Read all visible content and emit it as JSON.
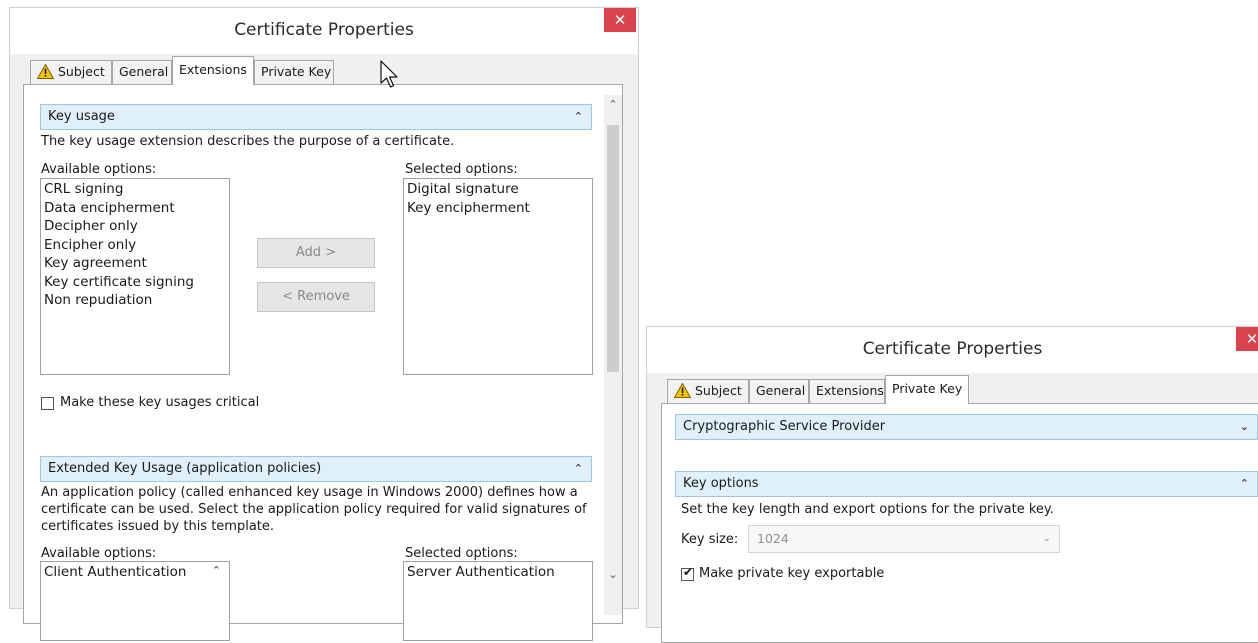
{
  "dialog1": {
    "title": "Certificate Properties",
    "close_glyph": "✕",
    "tabs": [
      {
        "label": "Subject",
        "warning": true
      },
      {
        "label": "General"
      },
      {
        "label": "Extensions",
        "active": true
      },
      {
        "label": "Private Key"
      }
    ],
    "key_usage": {
      "header": "Key usage",
      "description": "The key usage extension describes the purpose of a certificate.",
      "available_label": "Available options:",
      "available": [
        "CRL signing",
        "Data encipherment",
        "Decipher only",
        "Encipher only",
        "Key agreement",
        "Key certificate signing",
        "Non repudiation"
      ],
      "selected_label": "Selected options:",
      "selected": [
        "Digital signature",
        "Key encipherment"
      ],
      "add_label": "Add >",
      "remove_label": "< Remove",
      "critical_label": "Make these key usages critical",
      "critical_checked": false
    },
    "eku": {
      "header": "Extended Key Usage (application policies)",
      "description_lines": [
        "An application policy (called enhanced key usage in Windows 2000) defines how a",
        "certificate can be used. Select the application policy required for valid signatures of",
        "certificates issued by this template."
      ],
      "available_label": "Available options:",
      "available": [
        "Client Authentication"
      ],
      "selected_label": "Selected options:",
      "selected": [
        "Server Authentication"
      ]
    }
  },
  "dialog2": {
    "title": "Certificate Properties",
    "close_glyph": "✕",
    "tabs": [
      {
        "label": "Subject",
        "warning": true
      },
      {
        "label": "General"
      },
      {
        "label": "Extensions"
      },
      {
        "label": "Private Key",
        "active": true
      }
    ],
    "csp_header": "Cryptographic Service Provider",
    "key_options_header": "Key options",
    "key_options_desc": "Set the key length and export options for the private key.",
    "key_size_label": "Key size:",
    "key_size_value": "1024",
    "exportable_label": "Make private key exportable",
    "exportable_checked": true
  },
  "glyphs": {
    "chevron_up": "⌃",
    "chevron_down": "⌄",
    "check": "✔"
  },
  "colors": {
    "close": "#d9434b",
    "section_header": "#dff0fa",
    "section_border": "#9fc7e2"
  }
}
